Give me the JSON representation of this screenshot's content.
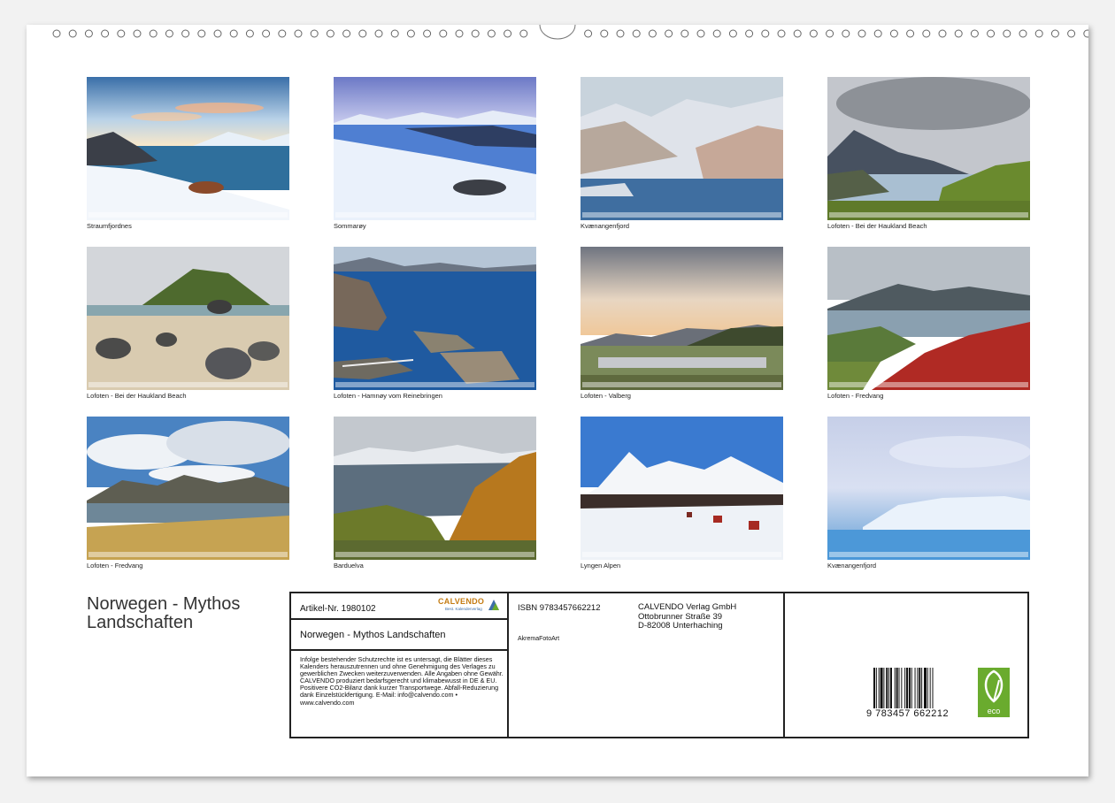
{
  "calendar": {
    "title": "Norwegen - Mythos Landschaften",
    "thumbnails": [
      {
        "caption": "Straumfjordnes",
        "scene": "snow-shore"
      },
      {
        "caption": "Sommarøy",
        "scene": "blue-snow-beach"
      },
      {
        "caption": "Kvænangenfjord",
        "scene": "fjord-mountains"
      },
      {
        "caption": "Lofoten - Bei der Haukland Beach",
        "scene": "cloudy-peak"
      },
      {
        "caption": "Lofoten - Bei der Haukland Beach",
        "scene": "beach-rocks"
      },
      {
        "caption": "Lofoten - Hamnøy vom Reinebringen",
        "scene": "aerial-fjord"
      },
      {
        "caption": "Lofoten - Valberg",
        "scene": "sunset-lake"
      },
      {
        "caption": "Lofoten - Fredvang",
        "scene": "red-heath"
      },
      {
        "caption": "Lofoten - Fredvang",
        "scene": "cloud-lake-grass"
      },
      {
        "caption": "Barduelva",
        "scene": "autumn-valley"
      },
      {
        "caption": "Lyngen Alpen",
        "scene": "snow-peak-village"
      },
      {
        "caption": "Kvænangenfjord",
        "scene": "misty-blue"
      }
    ]
  },
  "info": {
    "artikel": "Artikel-Nr. 1980102",
    "logo": {
      "name": "CALVENDO",
      "tagline": "Best. Kalenderverlag"
    },
    "subtitle": "Norwegen - Mythos Landschaften",
    "legal": "Infolge bestehender Schutzrechte ist es untersagt, die Blätter dieses Kalenders herauszutrennen und ohne Genehmigung des Verlages zu gewerblichen Zwecken weiterzuverwenden. Alle Angaben ohne Gewähr. CALVENDO produziert bedarfsgerecht und klimabewusst in DE & EU. Positivere CO2-Bilanz dank kurzer Transportwege. Abfall-Reduzierung dank Einzelstückfertigung. E-Mail: info@calvendo.com • www.calvendo.com",
    "isbn": "ISBN 9783457662212",
    "publisher": [
      "CALVENDO Verlag GmbH",
      "Ottobrunner Straße 39",
      "D-82008 Unterhaching"
    ],
    "author": "AkremaFotoArt",
    "barcode_number": "9 783457 662212",
    "eco_label": "eco"
  },
  "colors": {
    "accent_logo": "#c47b12",
    "eco_green": "#6aab2e",
    "frame": "#222222"
  }
}
